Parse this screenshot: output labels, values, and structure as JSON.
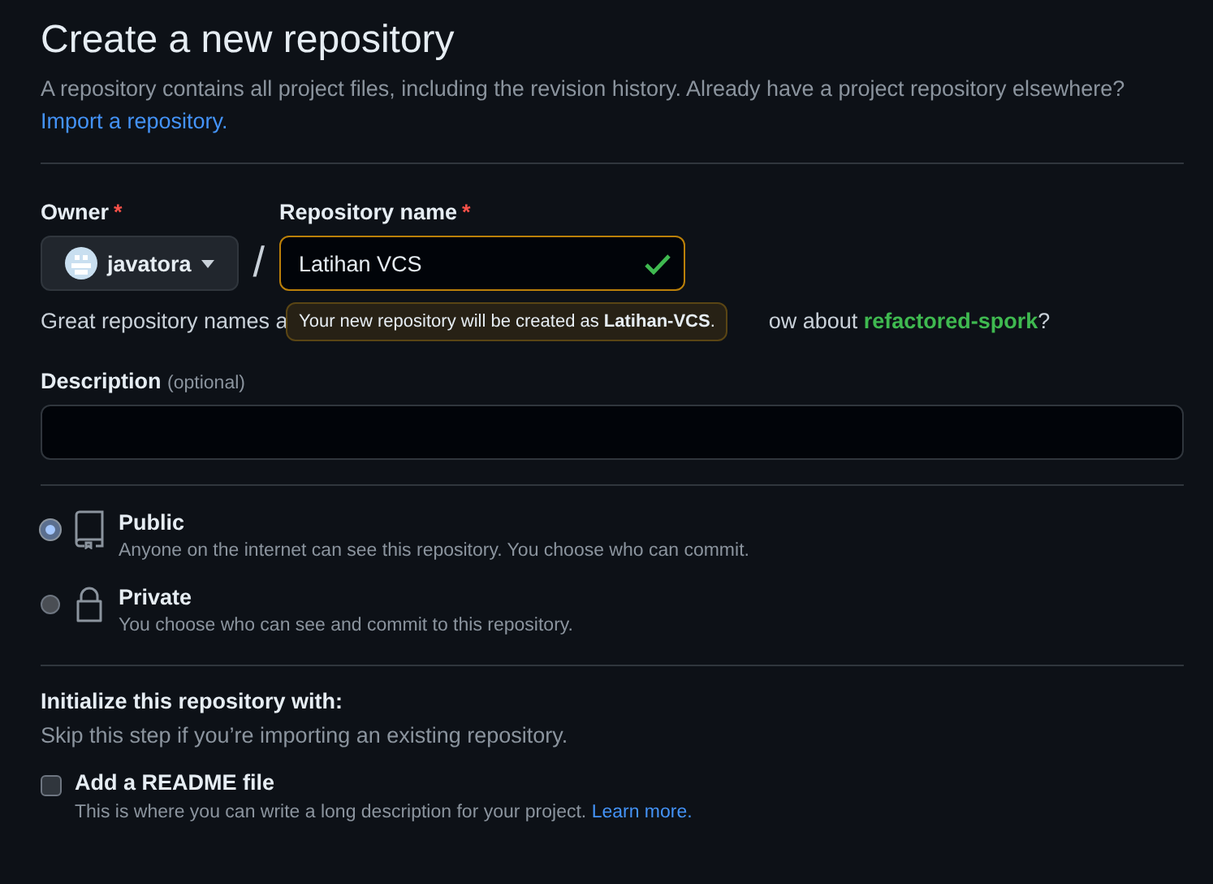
{
  "header": {
    "title": "Create a new repository",
    "description": "A repository contains all project files, including the revision history. Already have a project repository elsewhere?",
    "import_link": "Import a repository."
  },
  "owner": {
    "label": "Owner",
    "required_mark": "*",
    "value": "javatora"
  },
  "separator": "/",
  "repository_name": {
    "label": "Repository name",
    "required_mark": "*",
    "value": "Latihan VCS",
    "valid": true
  },
  "tooltip": "Your new repository will be created as **Latihan-VCS**.",
  "hint": {
    "before": "Great repository names a",
    "after": "ow about ",
    "suggestion": "refactored-spork",
    "end": "?"
  },
  "description_field": {
    "label": "Description",
    "optional": "(optional)"
  },
  "visibility": [
    {
      "kind": "public",
      "title": "Public",
      "text": "Anyone on the internet can see this repository. You choose who can commit.",
      "selected": true
    },
    {
      "kind": "private",
      "title": "Private",
      "text": "You choose who can see and commit to this repository.",
      "selected": false
    }
  ],
  "initialize": {
    "title": "Initialize this repository with:",
    "subtitle": "Skip this step if you’re importing an existing repository.",
    "options": [
      {
        "title": "Add a README file",
        "text": "This is where you can write a long description for your project.",
        "link": "Learn more.",
        "checked": false
      }
    ]
  }
}
